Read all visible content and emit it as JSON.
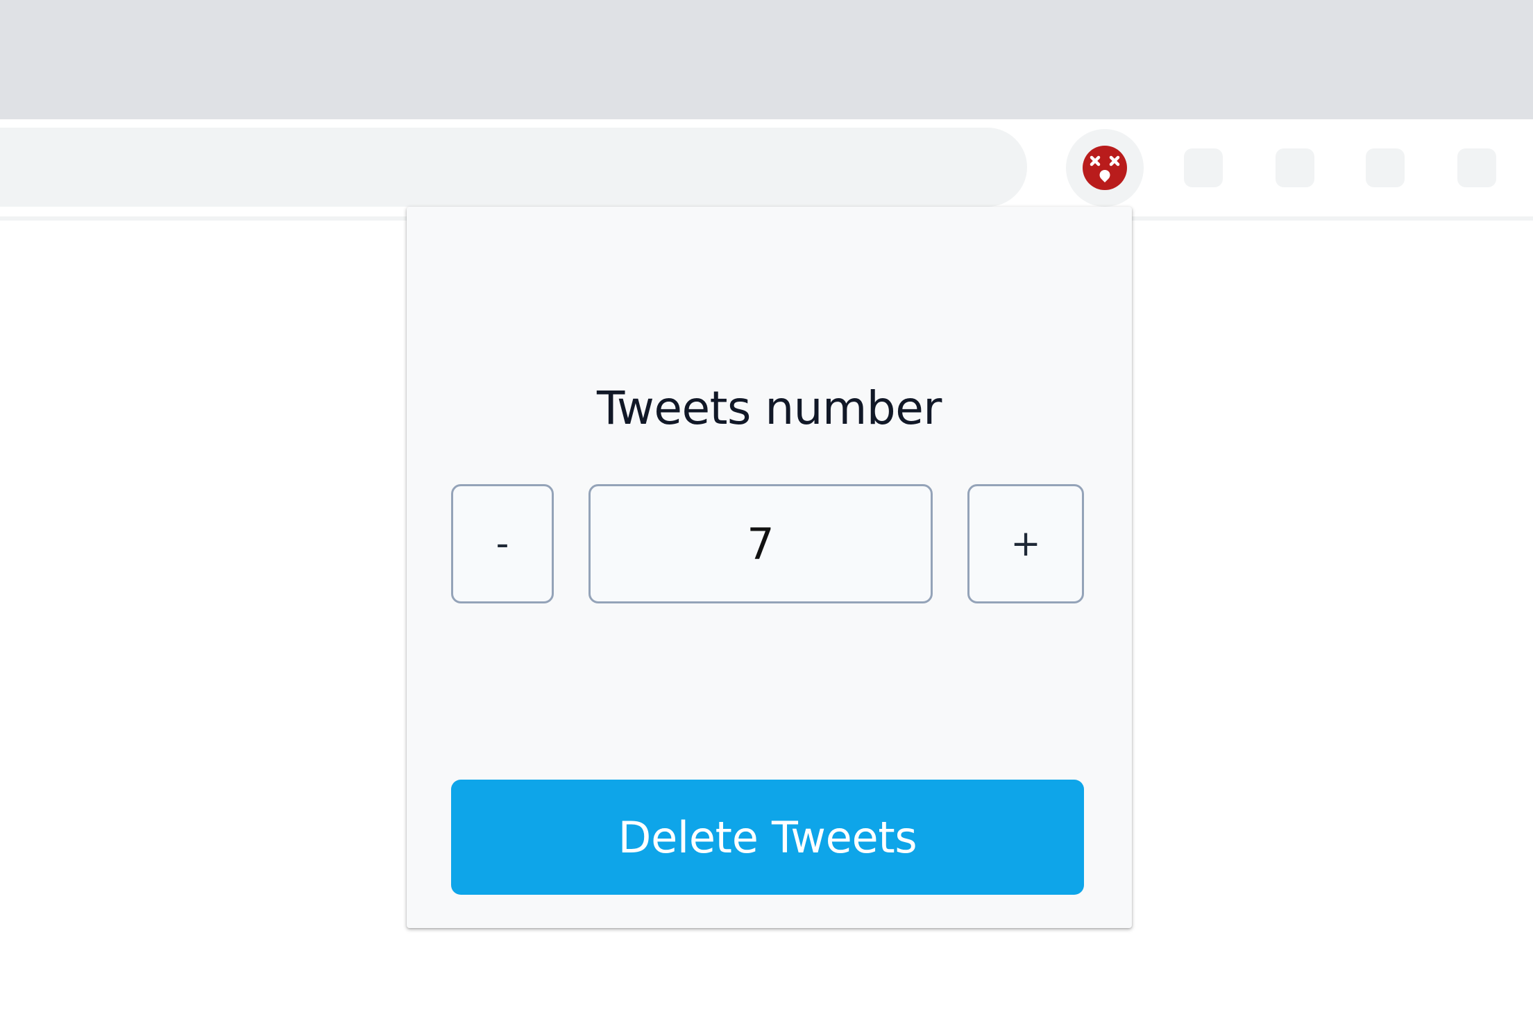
{
  "browser": {
    "extension_icon": "x-eyes-face-icon",
    "toolbar_icons": [
      "placeholder-icon",
      "placeholder-icon",
      "placeholder-icon",
      "placeholder-icon"
    ]
  },
  "popup": {
    "title": "Tweets number",
    "stepper": {
      "decrement_label": "-",
      "value": "7",
      "increment_label": "+"
    },
    "delete_button_label": "Delete Tweets"
  },
  "colors": {
    "accent": "#0ea5e9",
    "extension_icon_red": "#b91c1c"
  }
}
